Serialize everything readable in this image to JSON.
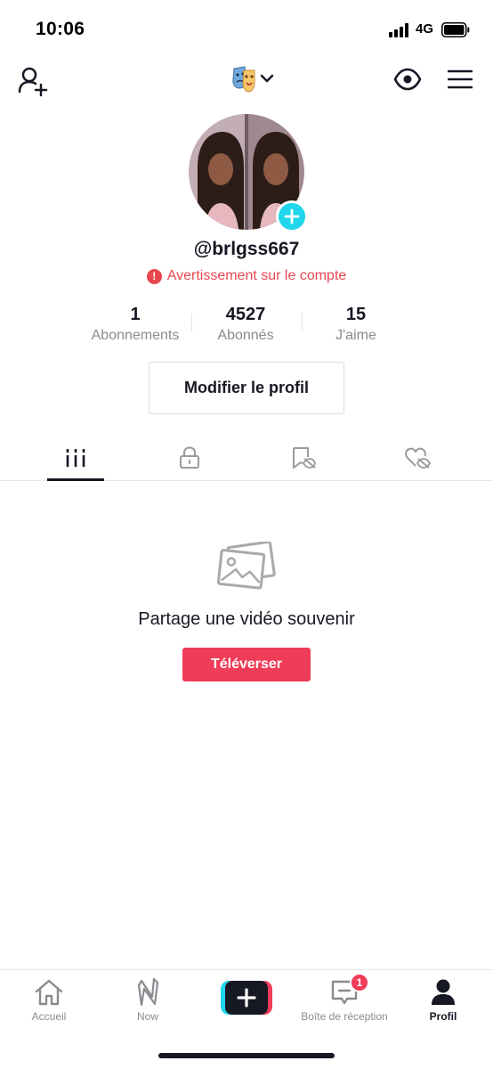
{
  "status_bar": {
    "time": "10:06",
    "network": "4G",
    "icons": [
      "signal-icon",
      "battery-icon"
    ]
  },
  "top_nav": {
    "icons": [
      "add-user-icon",
      "account-switch-icon",
      "eye-icon",
      "menu-icon"
    ]
  },
  "profile": {
    "username": "@brlgss667",
    "warning": "Avertissement sur le compte",
    "stats": [
      {
        "value": "1",
        "label": "Abonnements"
      },
      {
        "value": "4527",
        "label": "Abonnés"
      },
      {
        "value": "15",
        "label": "J'aime"
      }
    ],
    "edit_label": "Modifier le profil"
  },
  "tabs": {
    "items": [
      "videos-grid-icon",
      "private-lock-icon",
      "saved-hidden-icon",
      "liked-hidden-icon"
    ],
    "active_index": 0
  },
  "empty_state": {
    "title": "Partage une vidéo souvenir",
    "button_label": "Téléverser"
  },
  "bottom_nav": {
    "items": [
      {
        "label": "Accueil",
        "icon": "home-icon"
      },
      {
        "label": "Now",
        "icon": "now-icon"
      },
      {
        "label": "",
        "icon": "create-plus-icon"
      },
      {
        "label": "Boîte de réception",
        "icon": "inbox-icon",
        "badge": "1"
      },
      {
        "label": "Profil",
        "icon": "profile-icon"
      }
    ],
    "active": "Profil"
  },
  "colors": {
    "accent": "#ef3c58",
    "cyan": "#20d5ec",
    "text": "#161823",
    "muted": "#8a8b91"
  }
}
